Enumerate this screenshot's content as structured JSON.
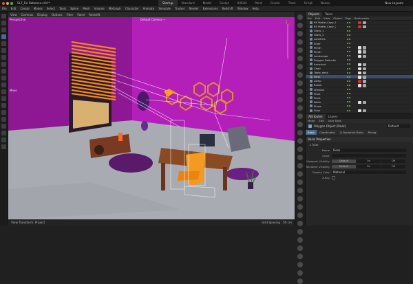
{
  "title": {
    "document": "SL7_Fin Rebonce.c4d *",
    "new_layouts": "New Layouts"
  },
  "layouts": [
    "Startup",
    "Standard",
    "Model",
    "Sculpt",
    "UVEdit",
    "Paint",
    "Groom",
    "Track",
    "Script",
    "Nodes"
  ],
  "active_layout": "Startup",
  "menu": [
    "File",
    "Edit",
    "Create",
    "Modes",
    "Select",
    "Tools",
    "Spline",
    "Mesh",
    "Volume",
    "MoGraph",
    "Character",
    "Animate",
    "Simulate",
    "Tracker",
    "Render",
    "Extensions",
    "Redshift",
    "Window",
    "Help"
  ],
  "viewport": {
    "menu": [
      "View",
      "Cameras",
      "Display",
      "Options",
      "Filter",
      "Panel",
      "Redshift"
    ],
    "label_view": "Perspective",
    "label_camera": "Default Camera ·∘",
    "label_move": "Move",
    "footer_left": "View Transform: Project",
    "footer_right": "Grid Spacing : 50 cm",
    "colors": {
      "wall": "#9f19a5",
      "floor": "#a6a9b0",
      "blinds": "#f28a18",
      "accent": "#ff9a1a"
    }
  },
  "objects_panel": {
    "tabs": [
      "Objects",
      "Takes"
    ],
    "menu": [
      "File",
      "Edit",
      "View",
      "Object",
      "Tags",
      "Bookmarks"
    ],
    "rows": [
      {
        "name": "RS Matte_Copy_1",
        "tag": "#d03030",
        "selected": false
      },
      {
        "name": "RS Matte_Copy_2",
        "tag": "#d03030",
        "selected": false
      },
      {
        "name": "Glass_1",
        "tag": "",
        "selected": false
      },
      {
        "name": "Glass_2",
        "tag": "",
        "selected": false
      },
      {
        "name": "Lanterns",
        "tag": "",
        "selected": false
      },
      {
        "name": "Shelf",
        "tag": "",
        "selected": false
      },
      {
        "name": "Plinth",
        "tag": "#e0e0e0",
        "selected": false
      },
      {
        "name": "Plinth",
        "tag": "#e0e0e0",
        "selected": false
      },
      {
        "name": "Landscape",
        "tag": "#e0e0e0",
        "selected": false
      },
      {
        "name": "Polygon Reduction",
        "tag": "",
        "selected": false
      },
      {
        "name": "Armchair",
        "tag": "#e0e0e0",
        "selected": false
      },
      {
        "name": "Chair",
        "tag": "#e0e0e0",
        "selected": false
      },
      {
        "name": "Table_desk",
        "tag": "#e0e0e0",
        "selected": false
      },
      {
        "name": "Desk",
        "tag": "#e0e0e0",
        "selected": true
      },
      {
        "name": "Lamp",
        "tag": "#d03030",
        "selected": false
      },
      {
        "name": "Blinds",
        "tag": "#e0e0e0",
        "selected": false
      },
      {
        "name": "Window",
        "tag": "",
        "selected": false
      },
      {
        "name": "Plant",
        "tag": "",
        "selected": false
      },
      {
        "name": "Plant",
        "tag": "",
        "selected": false
      },
      {
        "name": "Walls",
        "tag": "#e0e0e0",
        "selected": false
      },
      {
        "name": "Plane",
        "tag": "",
        "selected": false
      },
      {
        "name": "Floor",
        "tag": "#e0e0e0",
        "selected": false
      }
    ]
  },
  "attributes_panel": {
    "tabs": [
      "Attributes",
      "Layers"
    ],
    "menu": [
      "Mode",
      "Edit",
      "User Data"
    ],
    "object_type": "Polygon Object [Desk]",
    "preset": "Default",
    "sub_tabs": [
      "Basic",
      "Coordinates",
      "Q Dynamics Body",
      "Phong"
    ],
    "active_sub_tab": "Basic",
    "section": "Basic Properties",
    "icon_label": "Icon",
    "name_label": "Name",
    "name_value": "Desk",
    "layer_label": "Layer",
    "layer_value": "",
    "viewport_label": "Viewport Visibility",
    "render_label": "Renderer Visibility",
    "vis_options": [
      "Default",
      "On",
      "Off"
    ],
    "color_label": "Display Color",
    "color_value": "Material",
    "xray_label": "X-Ray"
  }
}
